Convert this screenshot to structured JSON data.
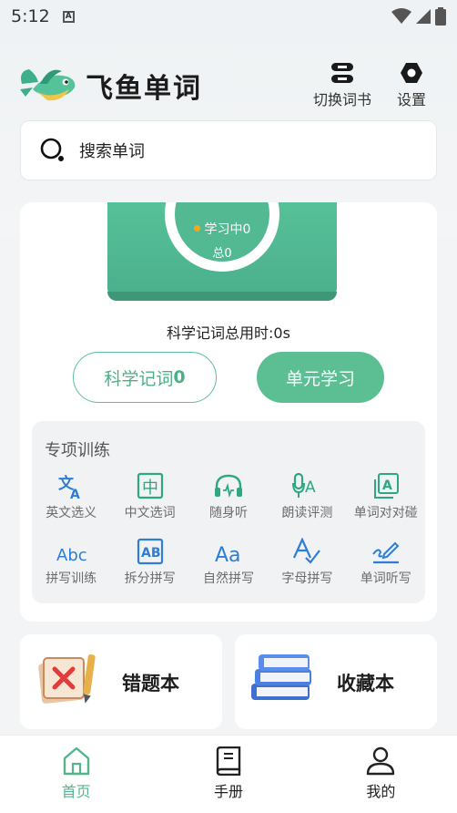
{
  "status_bar": {
    "time": "5:12",
    "a_label": "A"
  },
  "header": {
    "app_title": "飞鱼单词",
    "switch_book_label": "切换词书",
    "settings_label": "设置"
  },
  "search": {
    "placeholder": "搜索单词"
  },
  "progress": {
    "learning_label": "学习中0",
    "total_label": "总0",
    "total_time_label": "科学记词总用时:0s"
  },
  "buttons": {
    "scientific_label": "科学记词",
    "scientific_count": "0",
    "unit_label": "单元学习"
  },
  "training": {
    "title": "专项训练",
    "items": [
      {
        "label": "英文选义",
        "icon": "translate-icon"
      },
      {
        "label": "中文选词",
        "icon": "chinese-char-icon"
      },
      {
        "label": "随身听",
        "icon": "headphones-icon"
      },
      {
        "label": "朗读评测",
        "icon": "pronounce-icon"
      },
      {
        "label": "单词对对碰",
        "icon": "match-icon"
      },
      {
        "label": "拼写训练",
        "icon": "abc-icon"
      },
      {
        "label": "拆分拼写",
        "icon": "ab-split-icon"
      },
      {
        "label": "自然拼写",
        "icon": "phonics-icon"
      },
      {
        "label": "字母拼写",
        "icon": "letter-spell-icon"
      },
      {
        "label": "单词听写",
        "icon": "dictation-icon"
      }
    ]
  },
  "cards": {
    "wrong_book_label": "错题本",
    "favorites_label": "收藏本"
  },
  "tabbar": {
    "home_label": "首页",
    "manual_label": "手册",
    "mine_label": "我的"
  },
  "colors": {
    "accent": "#52b58c",
    "book": "#4fb78f",
    "dot": "#f5a623"
  }
}
